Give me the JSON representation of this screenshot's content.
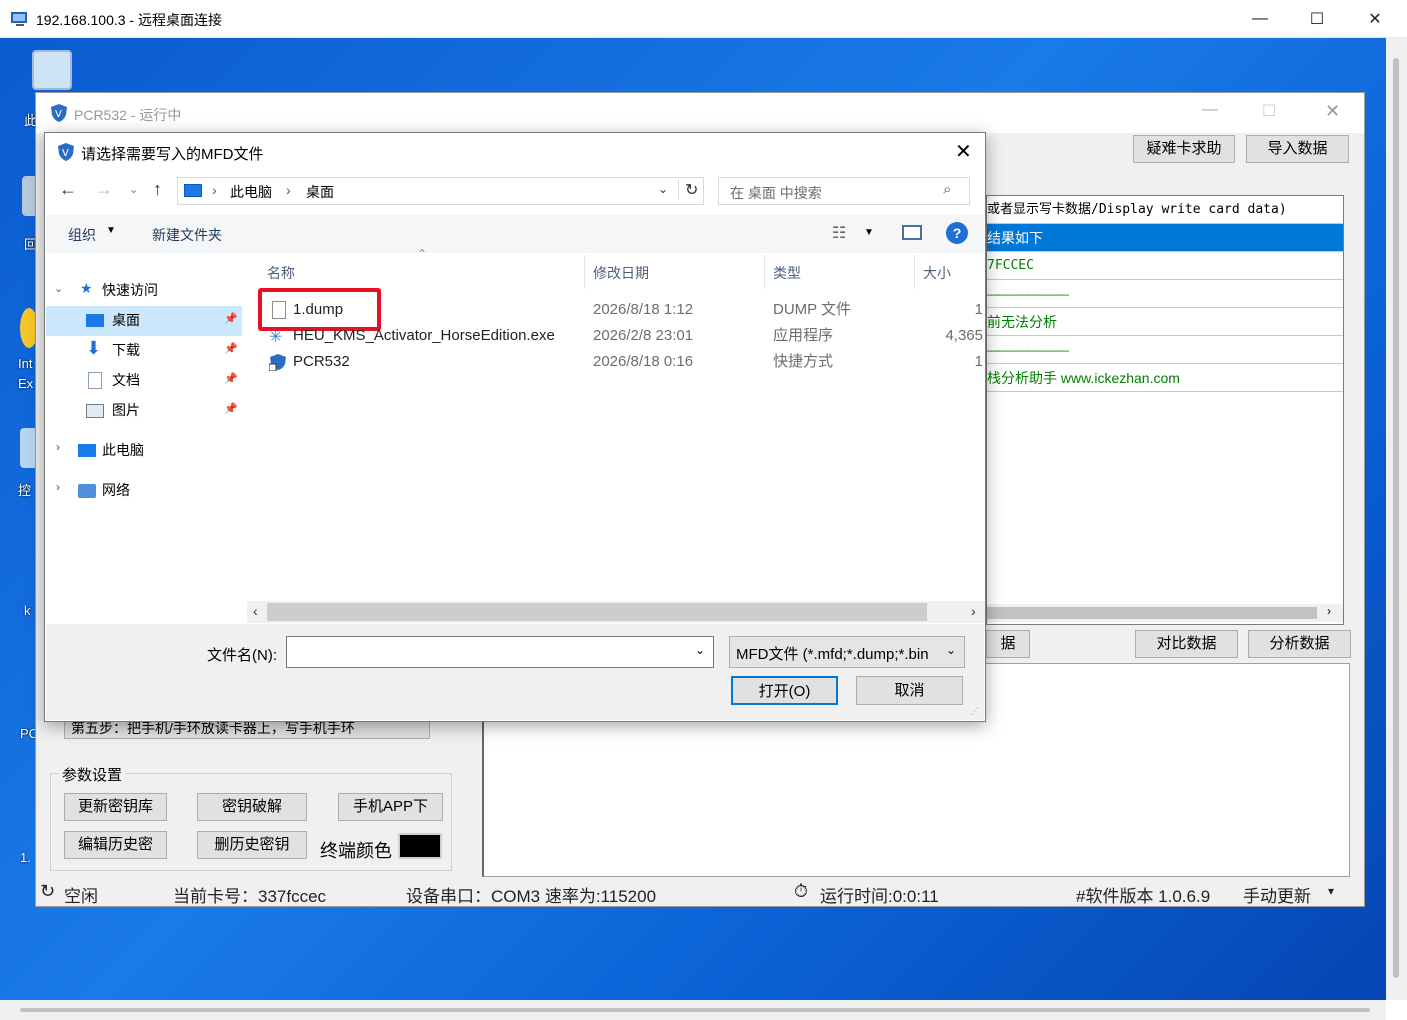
{
  "rdp": {
    "title": "192.168.100.3 - 远程桌面连接"
  },
  "desktop": {
    "labels": [
      "此",
      "回",
      "Int",
      "Ex",
      "控",
      "k",
      "PC",
      "1."
    ]
  },
  "app": {
    "title": "PCR532 - 运行中",
    "buttons": {
      "help": "疑难卡求助",
      "import": "导入数据",
      "compare": "对比数据",
      "analyze": "分析数据",
      "data_partial": "据"
    },
    "log": [
      {
        "text": "或者显示写卡数据/Display write card data)",
        "color": "#000000"
      },
      {
        "text": "结果如下",
        "color": "#ffffff",
        "selected": true
      },
      {
        "text": "7FCCEC",
        "color": "#008000"
      },
      {
        "text": "————————",
        "color": "#008000"
      },
      {
        "text": "前无法分析",
        "color": "#008000"
      },
      {
        "text": "————————",
        "color": "#008000"
      },
      {
        "text": "栈分析助手 www.ickezhan.com",
        "color": "#008000"
      }
    ],
    "step5": "第五步：把手机/手环放读卡器上，写手机手环",
    "params": {
      "title": "参数设置",
      "btn_update_keys": "更新密钥库",
      "btn_crack": "密钥破解",
      "btn_app": "手机APP下",
      "btn_edit_history": "编辑历史密",
      "btn_del_history": "删历史密钥",
      "term_color_label": "终端颜色"
    },
    "status": {
      "state": "空闲",
      "card_label": "当前卡号：337fccec",
      "port": "设备串口：COM3 速率为:115200",
      "runtime": "运行时间:0:0:11",
      "version": "#软件版本 1.0.6.9",
      "update": "手动更新"
    }
  },
  "dialog": {
    "title": "请选择需要写入的MFD文件",
    "breadcrumb": [
      "此电脑",
      "桌面"
    ],
    "search_placeholder": "在 桌面 中搜索",
    "toolbar": {
      "organize": "组织",
      "new_folder": "新建文件夹"
    },
    "nav": {
      "quick_access": "快速访问",
      "desktop": "桌面",
      "downloads": "下载",
      "documents": "文档",
      "pictures": "图片",
      "this_pc": "此电脑",
      "network": "网络"
    },
    "columns": {
      "name": "名称",
      "modified": "修改日期",
      "type": "类型",
      "size": "大小"
    },
    "files": [
      {
        "name": "1.dump",
        "modified": "2026/8/18 1:12",
        "type": "DUMP 文件",
        "size": "1",
        "icon": "file-icon"
      },
      {
        "name": "HEU_KMS_Activator_HorseEdition.exe",
        "modified": "2026/2/8 23:01",
        "type": "应用程序",
        "size": "4,365",
        "icon": "exe-icon"
      },
      {
        "name": "PCR532",
        "modified": "2026/8/18 0:16",
        "type": "快捷方式",
        "size": "1",
        "icon": "shortcut-icon"
      }
    ],
    "filename_label": "文件名(N):",
    "filename_value": "",
    "filter": "MFD文件 (*.mfd;*.dump;*.bin",
    "open_button": "打开(O)",
    "cancel_button": "取消"
  },
  "colors": {
    "accent": "#0078d7",
    "highlight": "#e81123",
    "green_text": "#008000",
    "log_select": "#0078d7"
  }
}
